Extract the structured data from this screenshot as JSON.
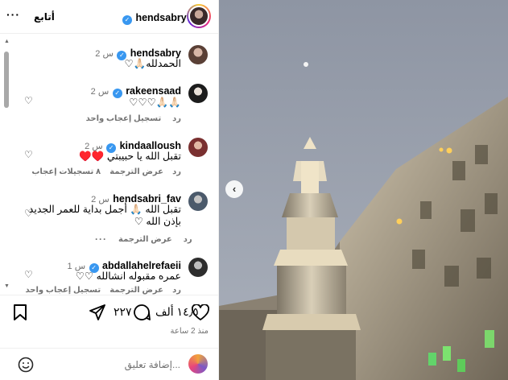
{
  "header": {
    "username": "hendsabry",
    "follow_label": "أتابع",
    "more_label": "···"
  },
  "comments": [
    {
      "user": "hendsabry",
      "time": "2 س",
      "text": "الحمدلله🙏🏻♡",
      "verified": true
    },
    {
      "user": "rakeensaad",
      "time": "2 س",
      "text": "🙏🏻🙏🏻♡♡♡",
      "verified": true,
      "likes": "تسجيل إعجاب واحد",
      "reply": "رد"
    },
    {
      "user": "kindaalloush",
      "time": "2 س",
      "text": "تقبل الله يا حبيبتي ♥️♥️",
      "verified": true,
      "likes": "٨ تسجيلات إعجاب",
      "reply": "رد",
      "translate": "عرض الترجمة"
    },
    {
      "user": "hendsabri_fav",
      "time": "2 س",
      "text": "تقبل الله 🙏🏻 أجمل بداية للعمر الجديد بإذن الله ♡",
      "verified": false,
      "reply": "رد",
      "translate": "عرض الترجمة",
      "more": "···"
    },
    {
      "user": "abdallahelrefaeii",
      "time": "1 س",
      "text": "عمره مقبوله انشالله ♡♡",
      "verified": true,
      "likes": "تسجيل إعجاب واحد",
      "reply": "رد",
      "translate": "عرض الترجمة"
    }
  ],
  "actions": {
    "likes_count": "١٤٫٥ ألف",
    "comments_count": "٢٢٧",
    "time_ago": "منذ 2 ساعة"
  },
  "footer": {
    "comment_placeholder": "إضافة تعليق..."
  },
  "colors": {
    "verified": "#3897f0",
    "secondary_text": "#737373",
    "border": "#efefef"
  }
}
